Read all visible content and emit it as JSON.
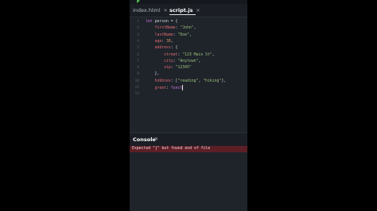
{
  "topbar": {
    "faint_text": "~~~ ~~~~ ~~~ ~~~~~~ ~~~~~"
  },
  "tabs": [
    {
      "label": "index.html",
      "close": "✕"
    },
    {
      "label": "script.js",
      "close": "✕"
    }
  ],
  "editor": {
    "line_numbers": [
      "1",
      "2",
      "3",
      "4",
      "5",
      "6",
      "7",
      "8",
      "9",
      "10",
      "11",
      "12"
    ],
    "lines": [
      [
        {
          "t": "let ",
          "c": "kw"
        },
        {
          "t": "person = {",
          "c": ""
        }
      ],
      [
        {
          "t": "    ",
          "c": ""
        },
        {
          "t": "firstName",
          "c": "prop"
        },
        {
          "t": ": ",
          "c": ""
        },
        {
          "t": "\"John\"",
          "c": "str"
        },
        {
          "t": ",",
          "c": ""
        }
      ],
      [
        {
          "t": "    ",
          "c": ""
        },
        {
          "t": "lastName",
          "c": "prop"
        },
        {
          "t": ": ",
          "c": ""
        },
        {
          "t": "\"Doe\"",
          "c": "str"
        },
        {
          "t": ",",
          "c": ""
        }
      ],
      [
        {
          "t": "    ",
          "c": ""
        },
        {
          "t": "age",
          "c": "prop"
        },
        {
          "t": ": ",
          "c": ""
        },
        {
          "t": "30",
          "c": "num"
        },
        {
          "t": ",",
          "c": ""
        }
      ],
      [
        {
          "t": "    ",
          "c": ""
        },
        {
          "t": "address",
          "c": "prop"
        },
        {
          "t": ": {",
          "c": ""
        }
      ],
      [
        {
          "t": "        ",
          "c": ""
        },
        {
          "t": "street",
          "c": "prop"
        },
        {
          "t": ": ",
          "c": ""
        },
        {
          "t": "\"123 Main St\"",
          "c": "str"
        },
        {
          "t": ",",
          "c": ""
        }
      ],
      [
        {
          "t": "        ",
          "c": ""
        },
        {
          "t": "city",
          "c": "prop"
        },
        {
          "t": ": ",
          "c": ""
        },
        {
          "t": "\"Anytown\"",
          "c": "str"
        },
        {
          "t": ",",
          "c": ""
        }
      ],
      [
        {
          "t": "        ",
          "c": ""
        },
        {
          "t": "zip",
          "c": "prop"
        },
        {
          "t": ": ",
          "c": ""
        },
        {
          "t": "\"12345\"",
          "c": "str"
        }
      ],
      [
        {
          "t": "    },",
          "c": ""
        }
      ],
      [
        {
          "t": "    ",
          "c": ""
        },
        {
          "t": "hobbies",
          "c": "prop"
        },
        {
          "t": ": [",
          "c": ""
        },
        {
          "t": "\"reading\"",
          "c": "str"
        },
        {
          "t": ", ",
          "c": ""
        },
        {
          "t": "\"hiking\"",
          "c": "str"
        },
        {
          "t": "],",
          "c": ""
        }
      ],
      [
        {
          "t": "    ",
          "c": ""
        },
        {
          "t": "greet",
          "c": "prop"
        },
        {
          "t": ": ",
          "c": ""
        },
        {
          "t": "funct",
          "c": "kw"
        }
      ],
      []
    ],
    "cursor_line": 11
  },
  "console": {
    "title": "Console",
    "close": "✕",
    "error": "Expected \"}\" but found end of file"
  },
  "colors": {
    "error_bg": "#5c1f25",
    "play": "#4caf50",
    "keyword": "#c678dd",
    "property": "#e06c75",
    "string": "#98c379",
    "number": "#d19a66"
  }
}
